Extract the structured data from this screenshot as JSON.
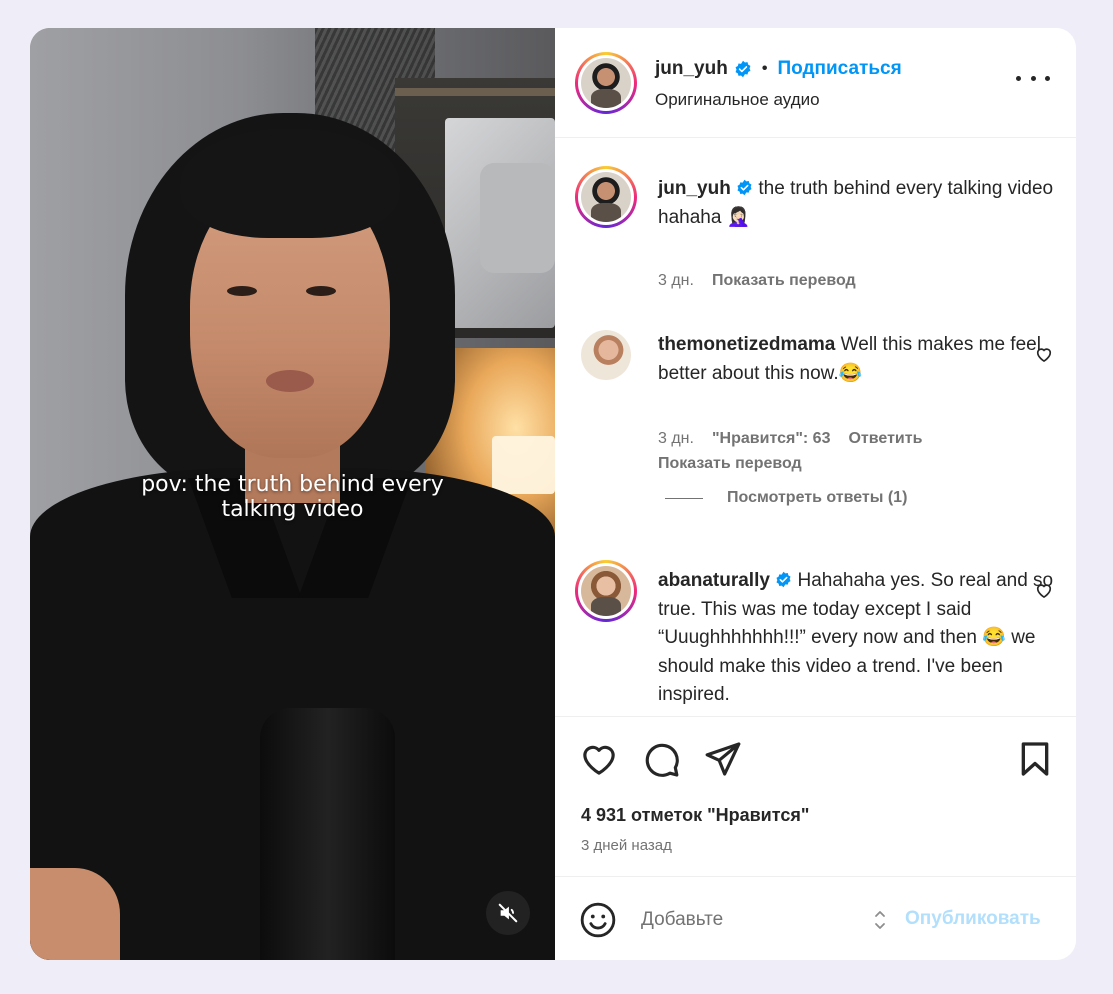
{
  "video": {
    "overlay_line1": "pov: the truth behind every",
    "overlay_line2": "talking video",
    "mute_icon": "speaker-muted-icon"
  },
  "header": {
    "username": "jun_yuh",
    "separator": "•",
    "follow_label": "Подписаться",
    "audio_label": "Оригинальное аудио"
  },
  "caption": {
    "username": "jun_yuh",
    "text": "the truth behind every talking video hahaha 🤦🏻‍♀️",
    "time": "3 дн.",
    "translate": "Показать перевод"
  },
  "comments": [
    {
      "username": "themonetizedmama",
      "text": "Well this makes me feel better about this now.😂",
      "time": "3 дн.",
      "likes": "\"Нравится\": 63",
      "reply": "Ответить",
      "translate": "Показать перевод",
      "view_replies": "Посмотреть ответы (1)"
    },
    {
      "username": "abanaturally",
      "text": "Hahahaha yes. So real and so true. This was me today except I said “Uuughhhhhhh!!!” every now and then 😂 we should make this video a trend. I've been inspired."
    }
  ],
  "stats": {
    "likes": "4 931 отметок \"Нравится\"",
    "ago": "3 дней назад"
  },
  "composer": {
    "placeholder": "Добавьте",
    "post_label": "Опубликовать"
  },
  "colors": {
    "accent": "#0095f6",
    "post_disabled": "#b2dffc",
    "text": "#262626",
    "muted": "#737373",
    "background": "#efeef8"
  }
}
